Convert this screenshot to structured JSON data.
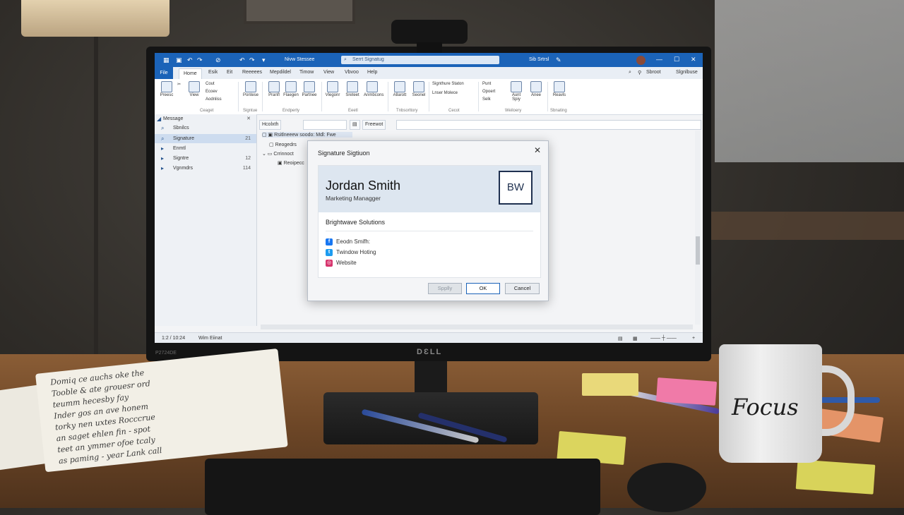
{
  "app": {
    "title": "Nivw Stessee",
    "search_placeholder": "Serrt Signatug",
    "user": "Sib Srtrsl",
    "window_controls": [
      "—",
      "☐",
      "✕"
    ]
  },
  "ribbon_tabs": [
    "File",
    "Home",
    "Esik",
    "Eit",
    "Reeeees",
    "Mepdildel",
    "Timow",
    "View",
    "Vbvoo",
    "Help"
  ],
  "ribbon_right": [
    "Sbroot",
    "Slgnlbuse"
  ],
  "ribbon": {
    "groups": [
      "Ceaget",
      "Signtue",
      "Endperty",
      "Eeetl",
      "Tnbsorttory",
      "Cecot",
      "Weiloery",
      "Sbnating"
    ],
    "buttons": [
      "Preesc",
      "View",
      "Pontese",
      "Pranfl",
      "Flaegen",
      "Partnee",
      "Vlegonr",
      "Sreteet",
      "Anmbcons",
      "Allarott",
      "Seonel",
      "Aunt Spiy",
      "Anee",
      "Reavls"
    ],
    "small_items": [
      "Cout",
      "Ecoev",
      "Aodnliss",
      "Signthure Staton",
      "Lnser Molece",
      "Punt",
      "Opoert",
      "Selk"
    ]
  },
  "left_pane": {
    "header": "Message",
    "items": [
      {
        "label": "Sbnilcs",
        "count": ""
      },
      {
        "label": "Signature",
        "count": "21"
      },
      {
        "label": "Enmtl",
        "count": ""
      },
      {
        "label": "Signtre",
        "count": "12"
      },
      {
        "label": "Vgnmdrs",
        "count": "114"
      }
    ]
  },
  "main": {
    "toolbar": [
      "Hcolxth",
      "Freewot"
    ],
    "tree": [
      "Rsitlneeew soodo: Mdl: Fwe",
      "Reogedrs",
      "Crrinnoct",
      "Reoipecc"
    ]
  },
  "status": {
    "left": "1:2 / 10:24",
    "middle": "Wim Eiinat"
  },
  "dialog": {
    "title": "Signature Sigtiuon",
    "name": "Jordan Smith",
    "role": "Marketing Managger",
    "logo_text": "BW",
    "company": "Brightwave Solutions",
    "links": [
      {
        "icon": "facebook-icon",
        "text": "Eeodn Smifh:",
        "color": "#1877f2"
      },
      {
        "icon": "twitter-icon",
        "text": "Twindow Hoting",
        "color": "#1d9bf0"
      },
      {
        "icon": "instagram-icon",
        "text": "Website",
        "color": "#d6336c"
      }
    ],
    "buttons": {
      "apply": "Spplly",
      "ok": "OK",
      "cancel": "Cancel"
    }
  },
  "monitor": {
    "brand": "DƐLL",
    "model_label": "P2724DE"
  },
  "desk": {
    "mug_text": "Focus"
  },
  "notebook_lines": [
    "Domiq  ce  auchs  oke  the",
    "Tooble  &  ate  grouesr  ord",
    "teumm  hecesby  fay",
    "Inder  gos  an  ave  honem",
    "torky  nen  uxtes  Rocccrue",
    "an  saget  ehlen  fin  -  spot",
    "teet  an  ymmer  ofoe  tcaly",
    "as  paming  -  year  Lank  call"
  ],
  "colors": {
    "accent": "#1b63b8",
    "signature_header": "#dde6f0",
    "logo_border": "#1f3150"
  }
}
